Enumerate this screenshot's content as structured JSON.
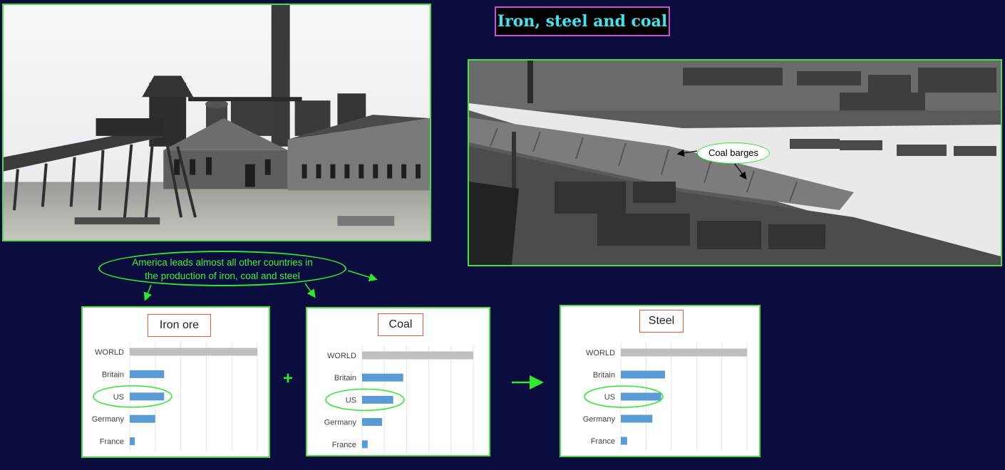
{
  "title": "Iron, steel and coal",
  "annotations": {
    "coal_barges": "Coal barges",
    "callout_line1": "America leads almost all other countries in",
    "callout_line2": "the production of iron, coal and steel"
  },
  "operators": {
    "plus": "+"
  },
  "colors": {
    "background": "#0b0d3f",
    "accent_green": "#2ee82e",
    "title_text": "#3fe6f0",
    "title_border": "#c94fd6",
    "world_bar": "#bfbfbf",
    "country_bar": "#5b9bd5",
    "chart_title_border": "#e35b3f"
  },
  "chart_data": [
    {
      "type": "bar",
      "orientation": "horizontal",
      "title": "Iron ore",
      "categories": [
        "WORLD",
        "Britain",
        "US",
        "Germany",
        "France"
      ],
      "values": [
        100,
        27,
        27,
        20,
        4
      ],
      "xlim": [
        0,
        100
      ],
      "grid": true,
      "highlight": "US"
    },
    {
      "type": "bar",
      "orientation": "horizontal",
      "title": "Coal",
      "categories": [
        "WORLD",
        "Britain",
        "US",
        "Germany",
        "France"
      ],
      "values": [
        100,
        37,
        28,
        18,
        5
      ],
      "xlim": [
        0,
        100
      ],
      "grid": true,
      "highlight": "US"
    },
    {
      "type": "bar",
      "orientation": "horizontal",
      "title": "Steel",
      "categories": [
        "WORLD",
        "Britain",
        "US",
        "Germany",
        "France"
      ],
      "values": [
        100,
        35,
        32,
        25,
        5
      ],
      "xlim": [
        0,
        100
      ],
      "grid": true,
      "highlight": "US"
    }
  ]
}
